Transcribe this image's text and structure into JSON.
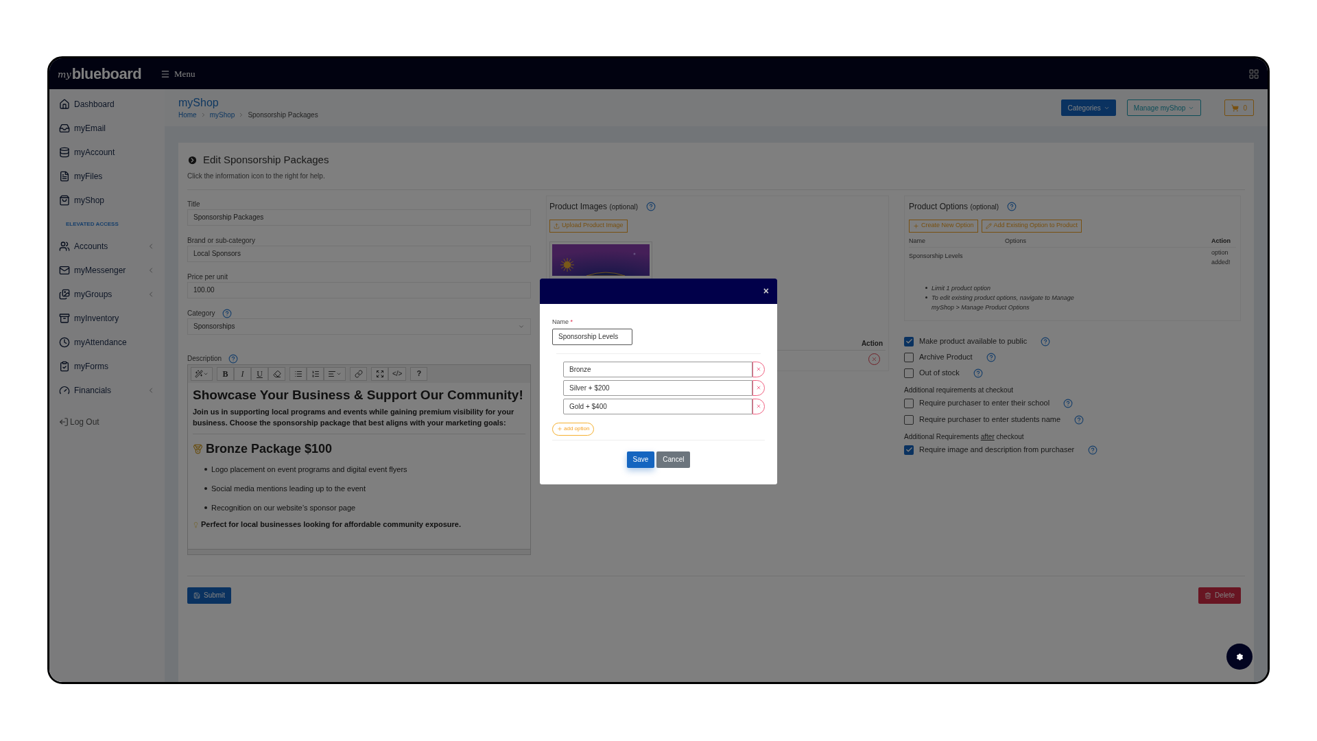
{
  "topbar": {
    "logo_prefix": "my",
    "logo": "blueboard",
    "menu_label": "Menu"
  },
  "sidebar": {
    "items": [
      {
        "label": "Dashboard",
        "expandable": false
      },
      {
        "label": "myEmail",
        "expandable": false
      },
      {
        "label": "myAccount",
        "expandable": false
      },
      {
        "label": "myFiles",
        "expandable": false
      },
      {
        "label": "myShop",
        "expandable": false
      }
    ],
    "section_heading": "ELEVATED ACCESS",
    "elevated_items": [
      {
        "label": "Accounts",
        "expandable": true
      },
      {
        "label": "myMessenger",
        "expandable": true
      },
      {
        "label": "myGroups",
        "expandable": true
      },
      {
        "label": "myInventory",
        "expandable": false
      },
      {
        "label": "myAttendance",
        "expandable": false
      },
      {
        "label": "myForms",
        "expandable": false
      },
      {
        "label": "Financials",
        "expandable": true
      }
    ],
    "logout": "Log Out"
  },
  "page_header": {
    "title": "myShop",
    "breadcrumbs": [
      {
        "label": "Home",
        "link": true
      },
      {
        "label": "myShop",
        "link": true
      },
      {
        "label": "Sponsorship Packages",
        "link": false
      }
    ],
    "categories_button": "Categories",
    "manage_button": "Manage myShop",
    "cart_count": "0"
  },
  "form": {
    "title": "Edit Sponsorship Packages",
    "subtitle": "Click the information icon to the right for help.",
    "fields": [
      {
        "label": "Title",
        "value": "Sponsorship Packages",
        "kind": "text",
        "help": false
      },
      {
        "label": "Brand or sub-category",
        "value": "Local Sponsors",
        "kind": "text",
        "help": false
      },
      {
        "label": "Price per unit",
        "value": "100.00",
        "kind": "text",
        "help": false
      },
      {
        "label": "Category",
        "value": "Sponsorships",
        "kind": "select",
        "help": true
      }
    ],
    "description": {
      "label": "Description",
      "help": true,
      "toolbar": [
        [
          {
            "kind": "wand"
          }
        ],
        [
          {
            "kind": "bold",
            "label": "B"
          },
          {
            "kind": "italic",
            "label": "I"
          },
          {
            "kind": "underline",
            "label": "U"
          },
          {
            "kind": "eraser"
          }
        ],
        [
          {
            "kind": "bullets"
          },
          {
            "kind": "numbers"
          },
          {
            "kind": "align"
          }
        ],
        [
          {
            "kind": "link"
          }
        ],
        [
          {
            "kind": "expand"
          },
          {
            "kind": "code",
            "label": "</>"
          }
        ],
        [
          {
            "kind": "help",
            "label": "?"
          }
        ]
      ],
      "heading": "Showcase Your Business & Support Our Community!",
      "intro": "Join us in supporting local programs and events while gaining premium visibility for your business. Choose the sponsorship package that best aligns with your marketing goals:",
      "package_title": "Bronze Package $100",
      "bullets": [
        "Logo placement on event programs and digital event flyers",
        "Social media mentions leading up to the event",
        "Recognition on our website’s sponsor page"
      ],
      "note": "Perfect for local businesses looking for affordable community exposure."
    },
    "submit": "Submit",
    "delete": "Delete"
  },
  "product_images": {
    "title": "Product Images",
    "optional": "(optional)",
    "upload": "Upload Product Image",
    "action_header": "Action"
  },
  "product_options": {
    "title": "Product Options",
    "optional": "(optional)",
    "create": "Create New Option",
    "add_existing": "Add Existing Option to Product",
    "columns": [
      "Name",
      "Options",
      "Action"
    ],
    "rows": [
      {
        "name": "Sponsorship Levels",
        "action": "option added!"
      }
    ],
    "notes": [
      "Limit 1 product option",
      "To edit existing product options, navigate to Manage myShop > Manage Product Options"
    ]
  },
  "settings": {
    "checkboxes": [
      {
        "label": "Make product available to public",
        "checked": true
      },
      {
        "label": "Archive Product",
        "checked": false
      },
      {
        "label": "Out of stock",
        "checked": false
      }
    ],
    "checkout_heading": "Additional requirements at checkout",
    "checkout_checkboxes": [
      {
        "label": "Require purchaser to enter their school",
        "checked": false
      },
      {
        "label": "Require purchaser to enter students name",
        "checked": false
      }
    ],
    "after_heading": {
      "before": "Additional Requirements",
      "underlined": "after",
      "after": "checkout"
    },
    "after_checkboxes": [
      {
        "label": "Require image and description from purchaser",
        "checked": true
      }
    ]
  },
  "modal": {
    "close": "×",
    "name_label": "Name",
    "required_mark": "*",
    "name_value": "Sponsorship Levels",
    "options": [
      "Bronze",
      "Silver + $200",
      "Gold + $400"
    ],
    "add_option": "add option",
    "save": "Save",
    "cancel": "Cancel"
  }
}
